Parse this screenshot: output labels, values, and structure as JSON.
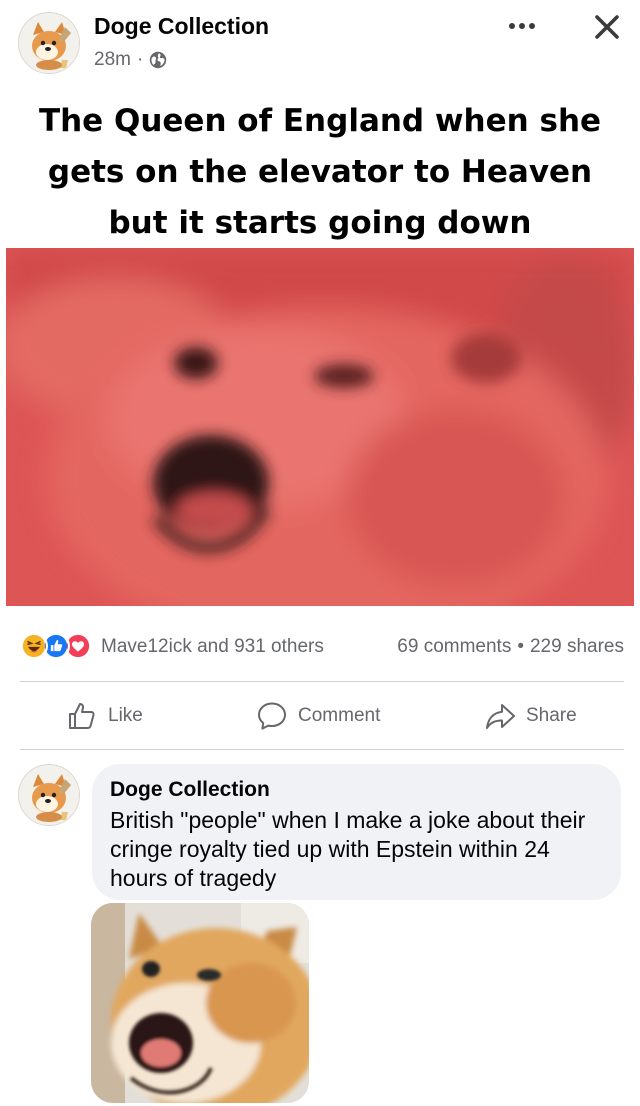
{
  "post": {
    "author": "Doge Collection",
    "time": "28m",
    "separator": "·",
    "caption_lines": [
      "The Queen of England when she",
      "gets on the elevator to Heaven",
      "but it starts going down"
    ],
    "image_icon": "screaming-doge-red-tint",
    "header_icons": [
      "more-options-icon",
      "close-icon",
      "globe-icon"
    ]
  },
  "engagement": {
    "reactions": [
      "haha-reaction-icon",
      "like-reaction-icon",
      "love-reaction-icon"
    ],
    "reactors": "Mave12ick and 931 others",
    "comments": "69 comments",
    "dot": "•",
    "shares": "229 shares"
  },
  "actions": {
    "like": "Like",
    "comment": "Comment",
    "share": "Share"
  },
  "comment": {
    "author": "Doge Collection",
    "text": "British \"people\" when I make a joke about their cringe royalty tied up with Epstein within 24 hours of tragedy",
    "image_icon": "screaming-doge"
  },
  "colors": {
    "text_primary": "#050505",
    "text_secondary": "#65676b",
    "divider": "#ced0d4",
    "bubble_bg": "#f0f2f5",
    "like_blue": "#1877f2",
    "love_red": "#f33e58",
    "haha_yellow": "#f7b125",
    "image_tint": "#de5757"
  }
}
